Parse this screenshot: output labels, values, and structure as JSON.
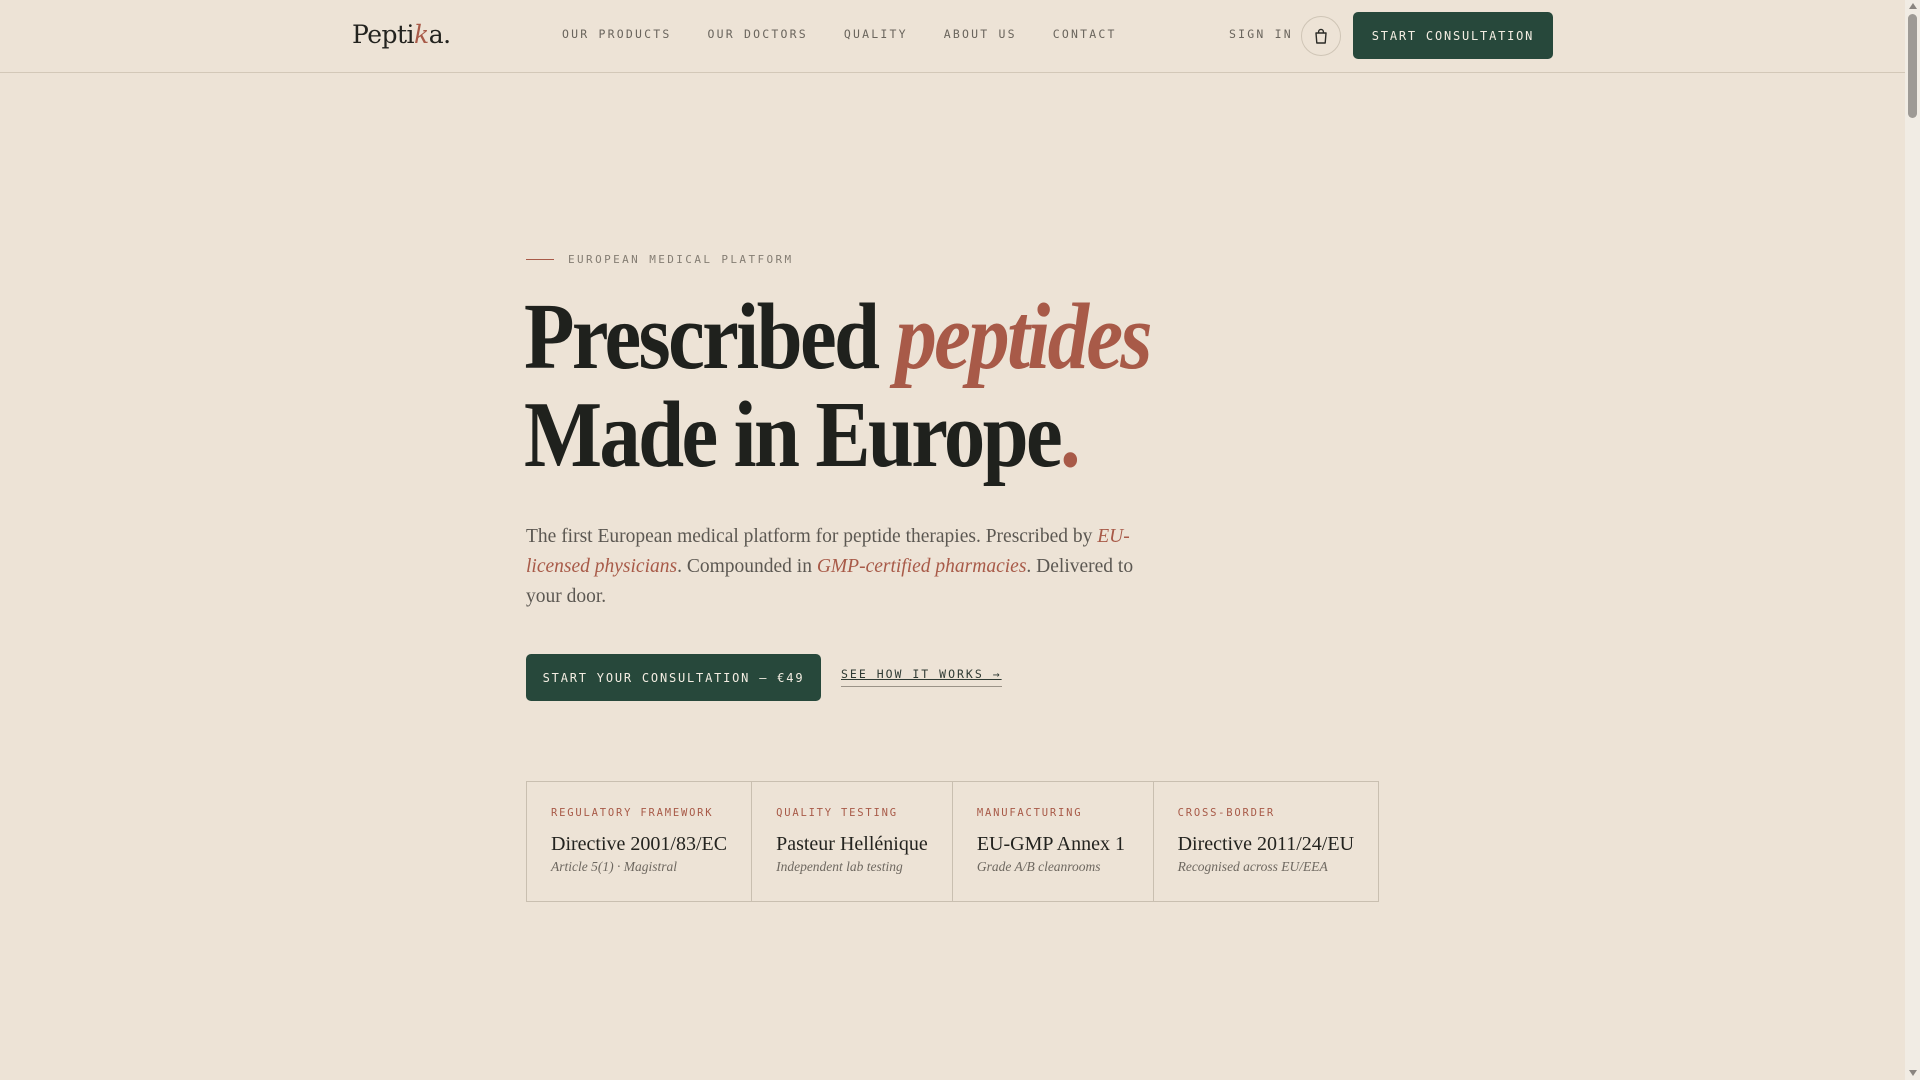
{
  "header": {
    "logo": {
      "pre": "Pepti",
      "accent": "k",
      "post": "a."
    },
    "nav": [
      "OUR PRODUCTS",
      "OUR DOCTORS",
      "QUALITY",
      "ABOUT US",
      "CONTACT"
    ],
    "sign_in": "SIGN IN",
    "cart_icon": "shopping-bag-icon",
    "cta": "START CONSULTATION"
  },
  "hero": {
    "eyebrow": "EUROPEAN MEDICAL PLATFORM",
    "headline": {
      "line1_plain": "Prescribed",
      "line1_accent": "peptides",
      "line2_plain": "Made in Europe",
      "line2_dot": "."
    },
    "lede": {
      "p1": "The first European medical platform for peptide therapies. Prescribed by ",
      "link1": "EU-licensed physicians",
      "p2": ". Compounded in ",
      "link2": "GMP-certified pharmacies",
      "p3": ". Delivered to your door."
    },
    "primary_cta": "START YOUR CONSULTATION — €49",
    "secondary_cta": "SEE HOW IT WORKS →"
  },
  "credentials": [
    {
      "kicker": "REGULATORY FRAMEWORK",
      "title": "Directive 2001/83/EC",
      "subtitle": "Article 5(1) · Magistral"
    },
    {
      "kicker": "QUALITY TESTING",
      "title": "Pasteur Hellénique",
      "subtitle": "Independent lab testing"
    },
    {
      "kicker": "MANUFACTURING",
      "title": "EU-GMP Annex 1",
      "subtitle": "Grade A/B cleanrooms"
    },
    {
      "kicker": "CROSS-BORDER",
      "title": "Directive 2011/24/EU",
      "subtitle": "Recognised across EU/EEA"
    }
  ],
  "colors": {
    "background": "#ede3d6",
    "accent": "#a85a48",
    "primary_button": "#27483b",
    "text": "#1f211d"
  }
}
